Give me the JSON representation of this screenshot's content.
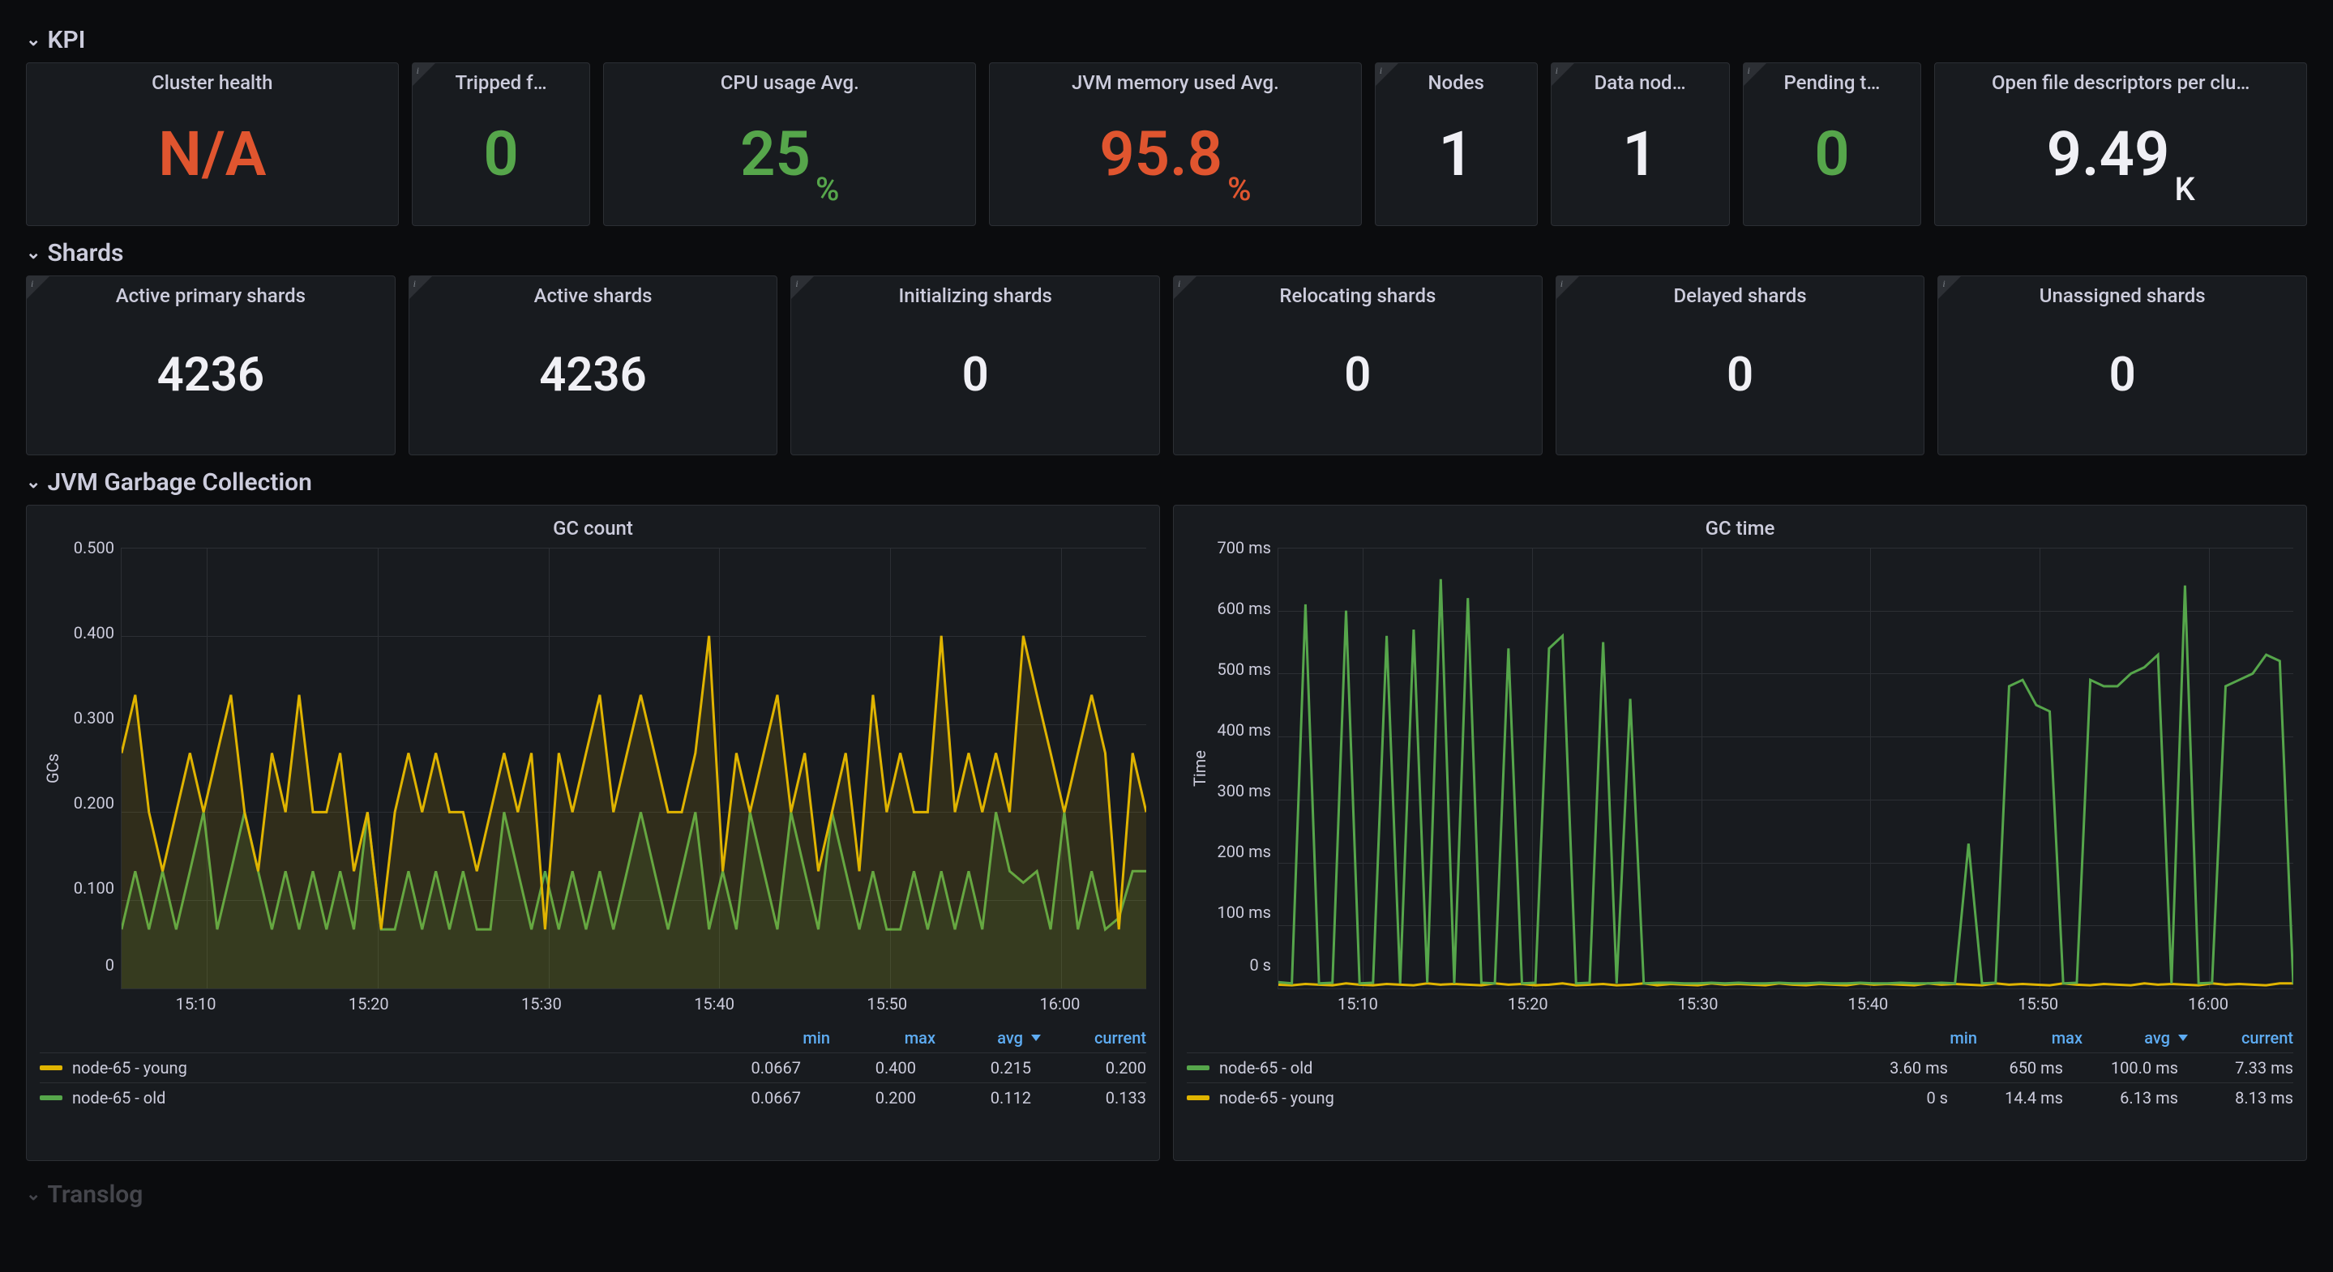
{
  "sections": {
    "kpi": {
      "title": "KPI"
    },
    "shards": {
      "title": "Shards"
    },
    "jvm_gc": {
      "title": "JVM Garbage Collection"
    },
    "translog": {
      "title": "Translog"
    }
  },
  "kpi_panels": {
    "cluster_health": {
      "title": "Cluster health",
      "value": "N/A",
      "color": "red",
      "info": false
    },
    "tripped": {
      "title": "Tripped f…",
      "value": "0",
      "color": "green",
      "info": true
    },
    "cpu": {
      "title": "CPU usage Avg.",
      "value": "25",
      "unit": "%",
      "color": "green",
      "info": false
    },
    "jvm_mem": {
      "title": "JVM memory used Avg.",
      "value": "95.8",
      "unit": "%",
      "color": "red",
      "info": false
    },
    "nodes": {
      "title": "Nodes",
      "value": "1",
      "color": "white",
      "info": true
    },
    "data_nodes": {
      "title": "Data nod…",
      "value": "1",
      "color": "white",
      "info": true
    },
    "pending": {
      "title": "Pending t…",
      "value": "0",
      "color": "green",
      "info": true
    },
    "open_fd": {
      "title": "Open file descriptors per clu…",
      "value": "9.49",
      "unit": "K",
      "color": "white",
      "info": false
    }
  },
  "shard_panels": {
    "active_primary": {
      "title": "Active primary shards",
      "value": "4236"
    },
    "active": {
      "title": "Active shards",
      "value": "4236"
    },
    "initializing": {
      "title": "Initializing shards",
      "value": "0"
    },
    "relocating": {
      "title": "Relocating shards",
      "value": "0"
    },
    "delayed": {
      "title": "Delayed shards",
      "value": "0"
    },
    "unassigned": {
      "title": "Unassigned shards",
      "value": "0"
    }
  },
  "chart_data": [
    {
      "id": "gc_count",
      "type": "line",
      "title": "GC count",
      "ylabel": "GCs",
      "y_ticks": [
        "0.500",
        "0.400",
        "0.300",
        "0.200",
        "0.100",
        "0"
      ],
      "x_ticks": [
        "15:10",
        "15:20",
        "15:30",
        "15:40",
        "15:50",
        "16:00"
      ],
      "ylim": [
        0,
        0.5
      ],
      "legend_headers": [
        "min",
        "max",
        "avg",
        "current"
      ],
      "sort_col": "avg",
      "series": [
        {
          "name": "node-65 - young",
          "color": "yellow",
          "stats": {
            "min": "0.0667",
            "max": "0.400",
            "avg": "0.215",
            "current": "0.200"
          },
          "values": [
            0.267,
            0.333,
            0.2,
            0.133,
            0.2,
            0.267,
            0.2,
            0.267,
            0.333,
            0.2,
            0.133,
            0.267,
            0.2,
            0.333,
            0.2,
            0.2,
            0.267,
            0.133,
            0.2,
            0.067,
            0.2,
            0.267,
            0.2,
            0.267,
            0.2,
            0.2,
            0.133,
            0.2,
            0.267,
            0.2,
            0.267,
            0.067,
            0.267,
            0.2,
            0.267,
            0.333,
            0.2,
            0.267,
            0.333,
            0.267,
            0.2,
            0.2,
            0.267,
            0.4,
            0.133,
            0.267,
            0.2,
            0.267,
            0.333,
            0.2,
            0.267,
            0.133,
            0.2,
            0.267,
            0.133,
            0.333,
            0.2,
            0.267,
            0.2,
            0.2,
            0.4,
            0.2,
            0.267,
            0.2,
            0.267,
            0.2,
            0.4,
            0.333,
            0.267,
            0.2,
            0.267,
            0.333,
            0.267,
            0.067,
            0.267,
            0.2
          ]
        },
        {
          "name": "node-65 - old",
          "color": "green",
          "stats": {
            "min": "0.0667",
            "max": "0.200",
            "avg": "0.112",
            "current": "0.133"
          },
          "values": [
            0.067,
            0.133,
            0.067,
            0.133,
            0.067,
            0.133,
            0.2,
            0.067,
            0.133,
            0.2,
            0.133,
            0.067,
            0.133,
            0.067,
            0.133,
            0.067,
            0.133,
            0.067,
            0.2,
            0.067,
            0.067,
            0.133,
            0.067,
            0.133,
            0.067,
            0.133,
            0.067,
            0.067,
            0.2,
            0.133,
            0.067,
            0.133,
            0.067,
            0.133,
            0.067,
            0.133,
            0.067,
            0.133,
            0.2,
            0.133,
            0.067,
            0.133,
            0.2,
            0.067,
            0.133,
            0.067,
            0.2,
            0.133,
            0.067,
            0.2,
            0.133,
            0.067,
            0.2,
            0.133,
            0.067,
            0.133,
            0.067,
            0.067,
            0.133,
            0.067,
            0.133,
            0.067,
            0.133,
            0.067,
            0.2,
            0.133,
            0.12,
            0.133,
            0.067,
            0.2,
            0.067,
            0.133,
            0.067,
            0.08,
            0.133,
            0.133
          ]
        }
      ]
    },
    {
      "id": "gc_time",
      "type": "line",
      "title": "GC time",
      "ylabel": "Time",
      "y_ticks": [
        "700 ms",
        "600 ms",
        "500 ms",
        "400 ms",
        "300 ms",
        "200 ms",
        "100 ms",
        "0 s"
      ],
      "x_ticks": [
        "15:10",
        "15:20",
        "15:30",
        "15:40",
        "15:50",
        "16:00"
      ],
      "ylim": [
        0,
        700
      ],
      "legend_headers": [
        "min",
        "max",
        "avg",
        "current"
      ],
      "sort_col": "avg",
      "series": [
        {
          "name": "node-65 - old",
          "color": "green",
          "stats": {
            "min": "3.60 ms",
            "max": "650 ms",
            "avg": "100.0 ms",
            "current": "7.33 ms"
          },
          "values": [
            10,
            8,
            610,
            8,
            9,
            600,
            8,
            9,
            560,
            8,
            570,
            9,
            650,
            8,
            620,
            9,
            8,
            540,
            8,
            9,
            540,
            560,
            8,
            9,
            550,
            8,
            460,
            8,
            9,
            9,
            8,
            8,
            9,
            8,
            9,
            8,
            8,
            9,
            8,
            8,
            9,
            8,
            8,
            9,
            8,
            8,
            9,
            8,
            8,
            9,
            8,
            230,
            8,
            9,
            480,
            490,
            450,
            440,
            8,
            9,
            490,
            480,
            480,
            500,
            510,
            530,
            8,
            640,
            8,
            9,
            480,
            490,
            500,
            530,
            520,
            7
          ]
        },
        {
          "name": "node-65 - young",
          "color": "yellow",
          "stats": {
            "min": "0 s",
            "max": "14.4 ms",
            "avg": "6.13 ms",
            "current": "8.13 ms"
          },
          "values": [
            6,
            5,
            7,
            6,
            5,
            8,
            6,
            5,
            7,
            6,
            5,
            8,
            6,
            7,
            6,
            5,
            8,
            6,
            7,
            5,
            6,
            8,
            5,
            6,
            7,
            5,
            6,
            8,
            5,
            7,
            6,
            5,
            8,
            6,
            7,
            6,
            5,
            8,
            6,
            5,
            7,
            6,
            5,
            8,
            6,
            7,
            6,
            5,
            8,
            6,
            7,
            6,
            5,
            8,
            6,
            7,
            6,
            5,
            8,
            6,
            5,
            7,
            6,
            5,
            8,
            6,
            7,
            6,
            5,
            8,
            6,
            7,
            6,
            5,
            8,
            8
          ]
        }
      ]
    }
  ]
}
